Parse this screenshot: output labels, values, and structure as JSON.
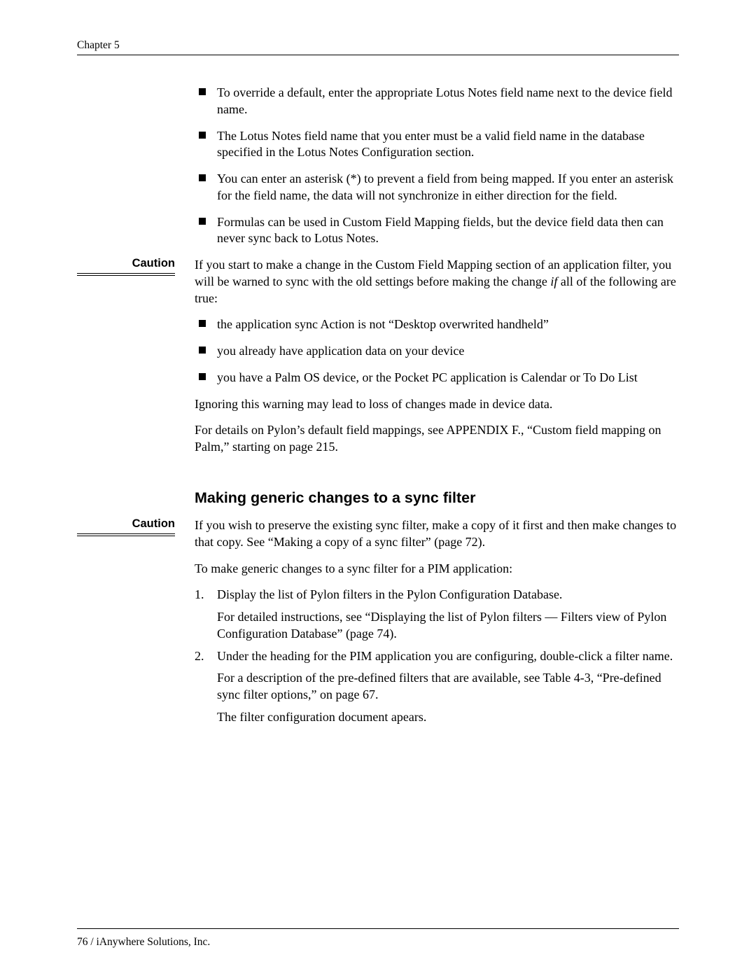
{
  "header": {
    "chapter": "Chapter 5"
  },
  "bullets1": {
    "b0": "To override a default, enter the appropriate Lotus Notes field name next to the device field name.",
    "b1": "The Lotus Notes field name that you enter must be a valid field name in the database specified in the Lotus Notes Configuration section.",
    "b2": "You can enter an asterisk (*) to prevent a field from being mapped. If you enter an asterisk for the field name, the data will not synchronize in either direction for the field.",
    "b3": "Formulas can be used in Custom Field Mapping fields, but the device field data then can never sync back to Lotus Notes."
  },
  "caution1": {
    "label": "Caution",
    "intro_pre": "If you start to make a change in the Custom Field Mapping section of an application filter, you will be warned to sync with the old settings before making the change ",
    "intro_italic": "if",
    "intro_post": " all of the following are true:",
    "b0": "the application sync Action is not “Desktop overwrited handheld”",
    "b1": "you already have application data on your device",
    "b2": "you have a Palm OS device, or the Pocket PC application is Calendar or To Do List",
    "warn": "Ignoring this warning may lead to loss of changes made in device data.",
    "ref": "For details on Pylon’s default field mappings, see APPENDIX F., “Custom field mapping on Palm,” starting on page 215."
  },
  "section2": {
    "heading": "Making generic changes to a sync filter",
    "caution_label": "Caution",
    "caution_text": "If you wish to preserve the existing sync filter, make a copy of it first and then make changes to that copy. See “Making a copy of a sync filter” (page 72).",
    "intro": "To make generic changes to a sync filter for a PIM application:",
    "step1": "Display the list of Pylon filters in the Pylon Configuration Database.",
    "step1_sub": "For detailed instructions, see “Displaying the list of Pylon filters — Filters view of Pylon Configuration Database” (page 74).",
    "step2": "Under the heading for the PIM application you are configuring, double-click a filter name.",
    "step2_sub1": "For a description of the pre-defined filters that are available, see Table 4-3, “Pre-defined sync filter options,” on page 67.",
    "step2_sub2": "The filter configuration document apears."
  },
  "footer": {
    "text": "76  /  iAnywhere Solutions, Inc."
  }
}
